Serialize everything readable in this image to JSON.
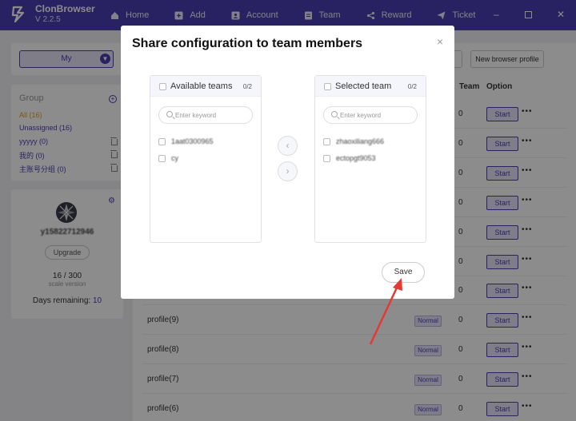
{
  "app": {
    "name": "ClonBrowser",
    "version": "V 2.2.5"
  },
  "nav": [
    {
      "label": "Home",
      "icon": "home-icon"
    },
    {
      "label": "Add",
      "icon": "add-icon"
    },
    {
      "label": "Account",
      "icon": "account-icon"
    },
    {
      "label": "Team",
      "icon": "team-icon"
    },
    {
      "label": "Reward",
      "icon": "share-icon"
    },
    {
      "label": "Ticket",
      "icon": "send-icon"
    }
  ],
  "sidebar": {
    "selector": "My",
    "group_title": "Group",
    "groups": [
      {
        "label": "All  (16)"
      },
      {
        "label": "Unassigned  (16)"
      },
      {
        "label": "yyyyy  (0)"
      },
      {
        "label": "我的  (0)"
      },
      {
        "label": "主账号分组  (0)"
      }
    ],
    "user": {
      "name": "y15822712946",
      "upgrade": "Upgrade",
      "usage": "16 / 300",
      "plan": "scale version",
      "days_label": "Days remaining:",
      "days_value": "10"
    }
  },
  "main": {
    "new_profile": "New browser profile",
    "columns": {
      "team": "Team",
      "option": "Option"
    },
    "rows": [
      {
        "team": "0",
        "start": "Start"
      },
      {
        "team": "0",
        "start": "Start"
      },
      {
        "team": "0",
        "start": "Start"
      },
      {
        "team": "0",
        "start": "Start"
      },
      {
        "team": "0",
        "start": "Start"
      },
      {
        "team": "0",
        "start": "Start"
      },
      {
        "team": "0",
        "start": "Start"
      },
      {
        "name": "profile(9)",
        "status": "Normal",
        "team": "0",
        "start": "Start"
      },
      {
        "name": "profile(8)",
        "status": "Normal",
        "team": "0",
        "start": "Start"
      },
      {
        "name": "profile(7)",
        "status": "Normal",
        "team": "0",
        "start": "Start"
      },
      {
        "name": "profile(6)",
        "status": "Normal",
        "team": "0",
        "start": "Start"
      }
    ]
  },
  "modal": {
    "title": "Share configuration to team members",
    "close": "×",
    "available": {
      "title": "Available teams",
      "count": "0/2",
      "placeholder": "Enter keyword",
      "items": [
        "1aat0300965",
        "cy"
      ]
    },
    "selected": {
      "title": "Selected team",
      "count": "0/2",
      "placeholder": "Enter keyword",
      "items": [
        "zhaoxiliang666",
        "ectopgt9053"
      ]
    },
    "move_left": "‹",
    "move_right": "›",
    "save": "Save"
  },
  "colors": {
    "brand": "#4a3fb5",
    "pointer": "#e53935"
  }
}
